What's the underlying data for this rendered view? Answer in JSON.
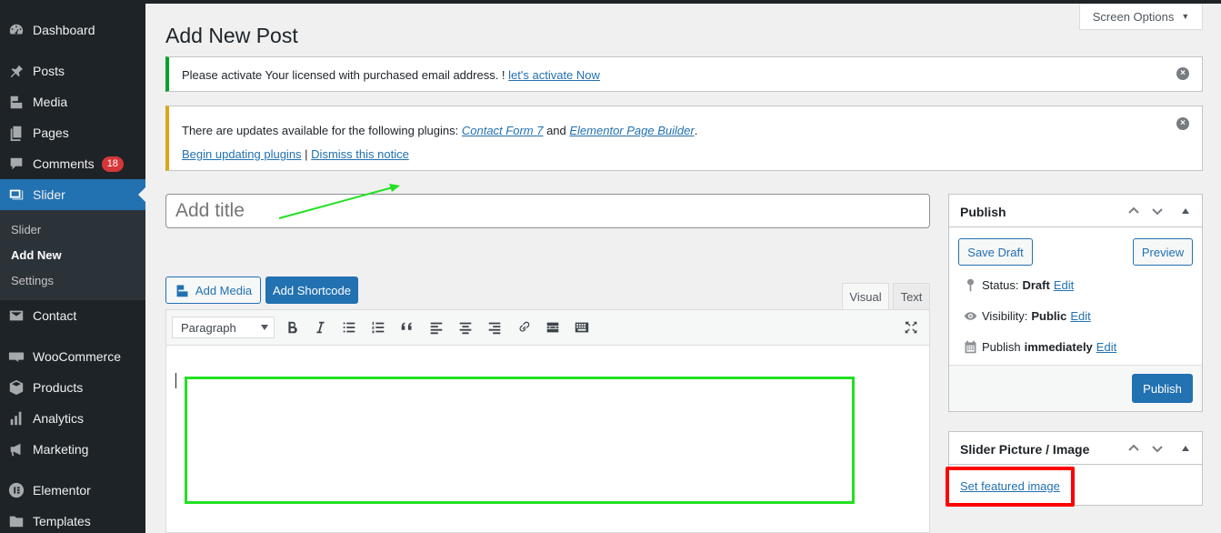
{
  "sidebar": {
    "items": [
      {
        "label": "Dashboard",
        "icon": "dashboard-icon"
      },
      {
        "label": "Posts",
        "icon": "pin-icon"
      },
      {
        "label": "Media",
        "icon": "media-icon"
      },
      {
        "label": "Pages",
        "icon": "pages-icon"
      },
      {
        "label": "Comments",
        "icon": "comment-icon",
        "badge": "18"
      },
      {
        "label": "Slider",
        "icon": "slider-icon",
        "active": true
      },
      {
        "label": "Contact",
        "icon": "mail-icon"
      },
      {
        "label": "WooCommerce",
        "icon": "woo-icon"
      },
      {
        "label": "Products",
        "icon": "box-icon"
      },
      {
        "label": "Analytics",
        "icon": "bar-chart-icon"
      },
      {
        "label": "Marketing",
        "icon": "megaphone-icon"
      },
      {
        "label": "Elementor",
        "icon": "elementor-icon"
      },
      {
        "label": "Templates",
        "icon": "folder-icon"
      }
    ],
    "submenu": [
      {
        "label": "Slider"
      },
      {
        "label": "Add New",
        "current": true
      },
      {
        "label": "Settings"
      }
    ]
  },
  "header": {
    "screen_options": "Screen Options",
    "page_title": "Add New Post"
  },
  "notices": {
    "license": {
      "text": "Please activate Your licensed with purchased email address. ! ",
      "link": "let's activate Now"
    },
    "updates": {
      "text_before": "There are updates available for the following plugins: ",
      "plugin1": "Contact Form 7",
      "and": " and ",
      "plugin2": "Elementor Page Builder",
      "period": ".",
      "begin_link": "Begin updating plugins",
      "separator": " | ",
      "dismiss_link": "Dismiss this notice"
    }
  },
  "editor": {
    "title_placeholder": "Add title",
    "add_media": "Add Media",
    "add_shortcode": "Add Shortcode",
    "tab_visual": "Visual",
    "tab_text": "Text",
    "format_select": "Paragraph",
    "toolbar_icons": [
      "bold-icon",
      "italic-icon",
      "bullet-list-icon",
      "numbered-list-icon",
      "blockquote-icon",
      "align-left-icon",
      "align-center-icon",
      "align-right-icon",
      "link-icon",
      "read-more-icon",
      "toolbar-toggle-icon",
      "fullscreen-icon"
    ]
  },
  "publish_box": {
    "title": "Publish",
    "save_draft": "Save Draft",
    "preview": "Preview",
    "status_label": "Status:",
    "status_value": "Draft",
    "visibility_label": "Visibility:",
    "visibility_value": "Public",
    "publish_label": "Publish",
    "publish_value": "immediately",
    "edit": "Edit",
    "publish_button": "Publish"
  },
  "slider_picture_box": {
    "title": "Slider Picture / Image",
    "set_featured": "Set featured image"
  },
  "colors": {
    "sidebar_bg": "#1d2327",
    "accent": "#2271b1",
    "annotation_green": "#22e022",
    "annotation_red": "#ff0000",
    "badge": "#d63638"
  }
}
